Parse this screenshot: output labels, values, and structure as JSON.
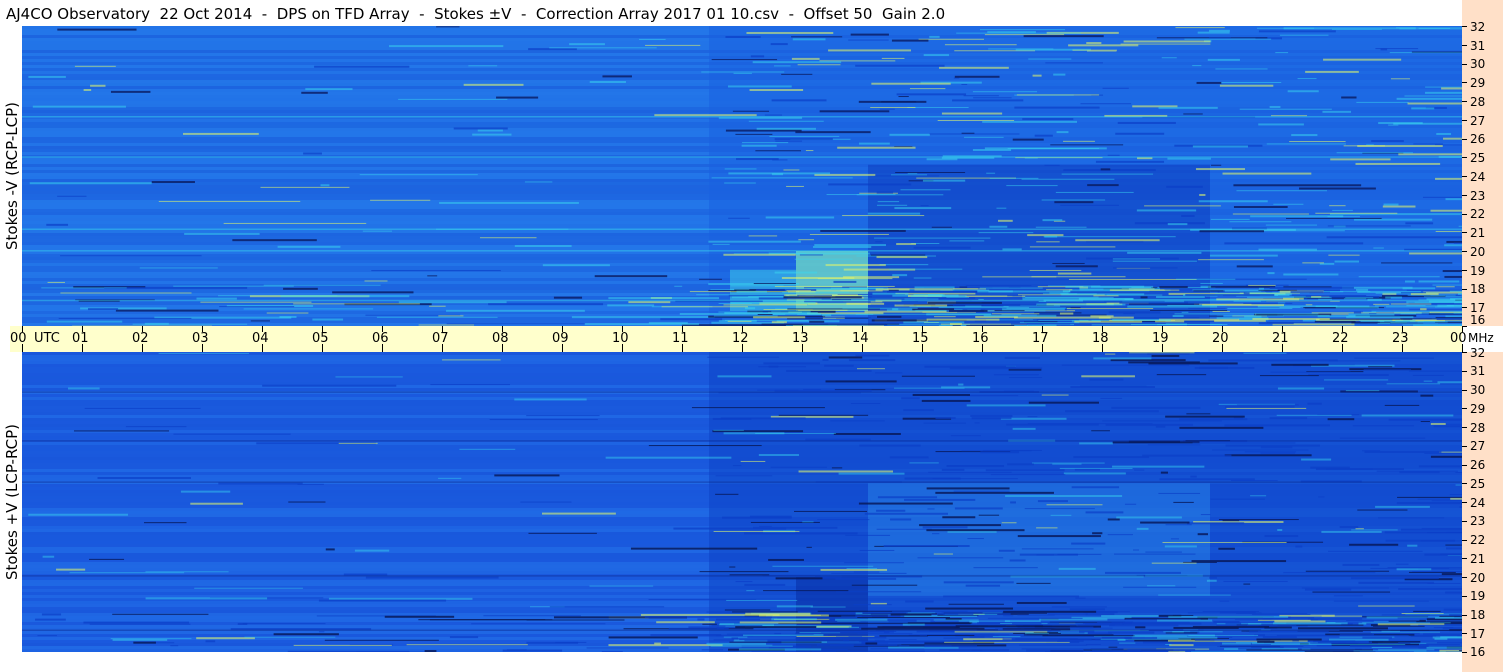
{
  "title": "AJ4CO Observatory  22 Oct 2014  -  DPS on TFD Array  -  Stokes ±V  -  Correction Array 2017 01 10.csv  -  Offset 50  Gain 2.0",
  "top_panel_label": "Stokes -V (RCP-LCP)",
  "bottom_panel_label": "Stokes +V (LCP-RCP)",
  "colors": {
    "base": "#1f6fe6",
    "deep": "#0b3fc8",
    "cyan": "#3ad8f0",
    "yellow_green": "#d8f070",
    "time_axis_bg": "#ffffcc",
    "freq_axis_bg": "#ffe0c8"
  },
  "chart_data": [
    {
      "type": "heatmap",
      "name": "Stokes -V (RCP-LCP)",
      "x": [
        "00",
        "01",
        "02",
        "03",
        "04",
        "05",
        "06",
        "07",
        "08",
        "09",
        "10",
        "11",
        "12",
        "13",
        "14",
        "15",
        "16",
        "17",
        "18",
        "19",
        "20",
        "21",
        "22",
        "23",
        "00"
      ],
      "xlabel": "UTC",
      "y_ticks": [
        16,
        17,
        18,
        19,
        20,
        21,
        22,
        23,
        24,
        25,
        26,
        27,
        28,
        29,
        30,
        31,
        32
      ],
      "ylabel": "MHz",
      "xlim": [
        0,
        24
      ],
      "ylim": [
        16,
        32
      ],
      "color_scale": [
        "#0b3fc8",
        "#1f6fe6",
        "#3ad8f0",
        "#d8f070"
      ]
    },
    {
      "type": "heatmap",
      "name": "Stokes +V (LCP-RCP)",
      "x": [
        "00",
        "01",
        "02",
        "03",
        "04",
        "05",
        "06",
        "07",
        "08",
        "09",
        "10",
        "11",
        "12",
        "13",
        "14",
        "15",
        "16",
        "17",
        "18",
        "19",
        "20",
        "21",
        "22",
        "23",
        "00"
      ],
      "xlabel": "UTC",
      "y_ticks": [
        16,
        17,
        18,
        19,
        20,
        21,
        22,
        23,
        24,
        25,
        26,
        27,
        28,
        29,
        30,
        31,
        32
      ],
      "ylabel": "MHz",
      "xlim": [
        0,
        24
      ],
      "ylim": [
        16,
        32
      ],
      "color_scale": [
        "#0b3fc8",
        "#1f6fe6",
        "#3ad8f0",
        "#d8f070"
      ]
    }
  ],
  "time_axis": {
    "labels": [
      "00",
      "UTC",
      "01",
      "02",
      "03",
      "04",
      "05",
      "06",
      "07",
      "08",
      "09",
      "10",
      "11",
      "12",
      "13",
      "14",
      "15",
      "16",
      "17",
      "18",
      "19",
      "20",
      "21",
      "22",
      "23",
      "00",
      "MHz"
    ]
  },
  "freq_axis": {
    "labels": [
      "32",
      "31",
      "30",
      "29",
      "28",
      "27",
      "26",
      "25",
      "24",
      "23",
      "22",
      "21",
      "20",
      "19",
      "18",
      "17",
      "16"
    ]
  }
}
